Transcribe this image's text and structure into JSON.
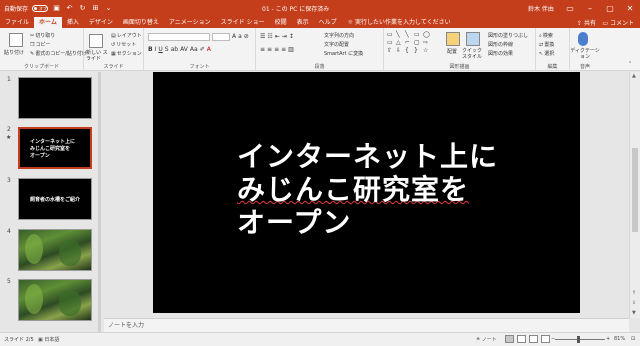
{
  "titlebar": {
    "autosave_label": "自動保存",
    "autosave_state": "オフ",
    "doc_title": "01 - この PC に保存済み",
    "user": "鈴木 伴由",
    "accent": "#c43e1c"
  },
  "tabs": [
    "ファイル",
    "ホーム",
    "挿入",
    "デザイン",
    "画面切り替え",
    "アニメーション",
    "スライド ショー",
    "校閲",
    "表示",
    "ヘルプ"
  ],
  "tell_me": "実行したい作業を入力してください",
  "share": "共有",
  "comments": "コメント",
  "ribbon": {
    "clipboard": {
      "paste": "貼り付け",
      "cut": "切り取り",
      "copy": "コピー",
      "format_painter": "書式のコピー/貼り付け",
      "label": "クリップボード"
    },
    "slides": {
      "new_slide": "新しい スライド",
      "layout": "レイアウト",
      "reset": "リセット",
      "section": "セクション",
      "label": "スライド"
    },
    "font": {
      "label": "フォント"
    },
    "paragraph": {
      "text_direction": "文字列の方向",
      "align_text": "文字の配置",
      "smartart": "SmartArt に変換",
      "label": "段落"
    },
    "drawing": {
      "arrange": "配置",
      "quick_styles": "クイック スタイル",
      "shape_fill": "図形の塗りつぶし",
      "shape_outline": "図形の枠線",
      "shape_effects": "図形の効果",
      "label": "図形描画"
    },
    "editing": {
      "find": "検索",
      "replace": "置換",
      "select": "選択",
      "label": "編集"
    },
    "voice": {
      "dictate": "ディクテーション",
      "label": "音声"
    }
  },
  "thumbnails": [
    {
      "number": "1",
      "type": "blank"
    },
    {
      "number": "2",
      "type": "text",
      "text_lines": [
        "インターネット上に",
        "みじんこ研究室を",
        "オープン"
      ],
      "star": "★"
    },
    {
      "number": "3",
      "type": "text",
      "caption": "飼育者の水槽をご紹介"
    },
    {
      "number": "4",
      "type": "photo",
      "photo": "aquarium-plants"
    },
    {
      "number": "5",
      "type": "photo",
      "photo": "aquarium-plants"
    }
  ],
  "slide": {
    "title_lines": [
      "インターネット上に",
      "みじんこ研究室を",
      "オープン"
    ],
    "background": "#000000",
    "text_color": "#ffffff"
  },
  "notes_placeholder": "ノートを入力",
  "statusbar": {
    "slide_info": "スライド 2/5",
    "language": "日本語",
    "notes": "ノート",
    "zoom": "81%"
  }
}
